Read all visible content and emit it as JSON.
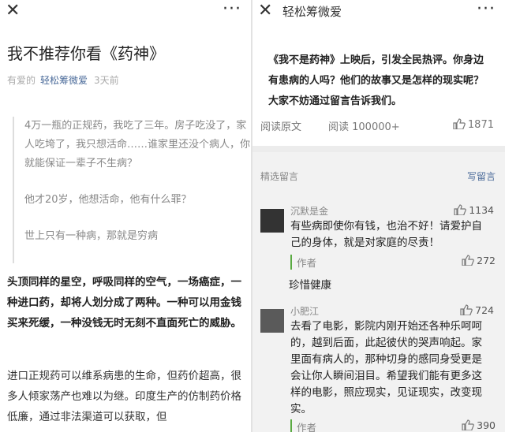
{
  "left": {
    "topbar": {
      "close": "✕",
      "more": "···"
    },
    "title": "我不推荐你看《药神》",
    "meta": {
      "tag": "有爱的",
      "account": "轻松筹微爱",
      "time": "3天前"
    },
    "quote": [
      "4万一瓶的正规药，我吃了三年。房子吃没了，家人吃垮了，我只想活命……谁家里还没个病人，你就能保证一辈子不生病？",
      "他才20岁，他想活命，他有什么罪？",
      "世上只有一种病，那就是穷病"
    ],
    "bold_para": "头顶同样的星空，呼吸同样的空气，一场癌症，一种进口药，却将人划分成了两种。一种可以用金钱买来死缓，一种没钱无时无刻不直面死亡的威胁。",
    "para2": "进口正规药可以维系病患的生命，但药价超高，很多人倾家荡产也难以为继。印度生产的仿制药价格低廉，通过非法渠道可以获取，但"
  },
  "right": {
    "topbar": {
      "close": "✕",
      "title": "轻松筹微爱",
      "more": "···"
    },
    "intro": "《我不是药神》上映后，引发全民热评。你身边有患病的人吗？他们的故事又是怎样的现实呢？大家不妨通过留言告诉我们。",
    "read_original": "阅读原文",
    "reads": "阅读 100000+",
    "likes": "1871",
    "section_label": "精选留言",
    "write_comment": "写留言",
    "comments": [
      {
        "name": "沉默是金",
        "likes": "1134",
        "text": "有些病即使你有钱，也治不好！请爱护自己的身体，就是对家庭的尽责！",
        "reply": {
          "who": "作者",
          "likes": "272",
          "text": "珍惜健康"
        }
      },
      {
        "name": "小肥江",
        "likes": "724",
        "text": "去看了电影，影院内刚开始还各种乐呵呵的，越到后面，此起彼伏的哭声响起。家里面有病人的，那种切身的感同身受更是会让你人瞬间泪目。希望我们能有更多这样的电影，照应现实，见证现实，改变现实。",
        "reply": {
          "who": "作者",
          "likes": "390"
        }
      }
    ]
  }
}
